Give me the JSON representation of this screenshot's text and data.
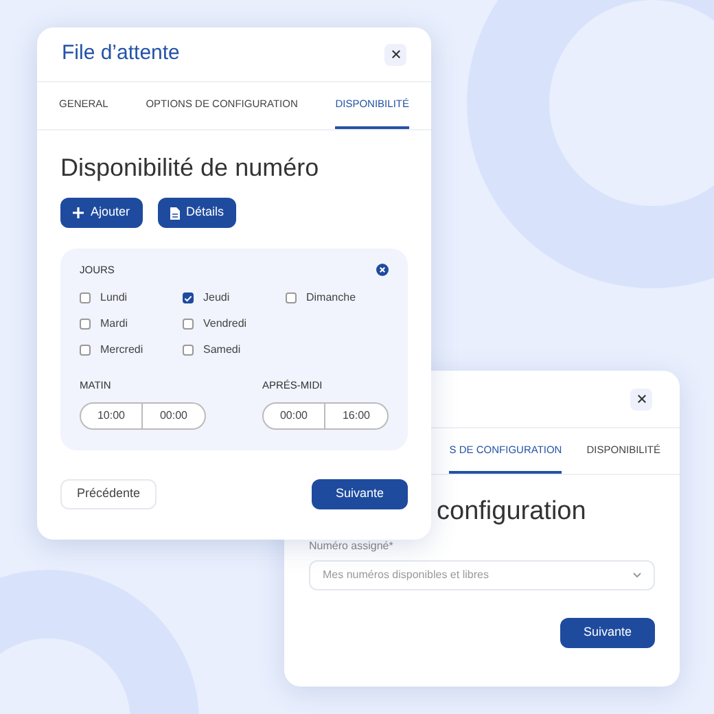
{
  "back_window": {
    "tabs": [
      {
        "label": "S DE CONFIGURATION",
        "selected": true
      },
      {
        "label": "DISPONIBILITÉ",
        "selected": false
      }
    ],
    "heading": "configuration",
    "field": {
      "label": "Numéro assigné*",
      "placeholder": "Mes numéros disponibles et libres"
    },
    "next_button": "Suivante"
  },
  "front_window": {
    "title": "File d’attente",
    "tabs": [
      {
        "label": "GENERAL",
        "selected": false
      },
      {
        "label": "OPTIONS DE CONFIGURATION",
        "selected": false
      },
      {
        "label": "DISPONIBILITÉ",
        "selected": true
      }
    ],
    "heading": "Disponibilité de numéro",
    "actions": [
      {
        "label": "Ajouter",
        "kind": "add"
      },
      {
        "label": "Détails",
        "kind": "document"
      }
    ],
    "days_panel": {
      "title": "JOURS",
      "day_columns": [
        [
          {
            "label": "Lundi",
            "checked": false
          },
          {
            "label": "Mardi",
            "checked": false
          },
          {
            "label": "Mercredi",
            "checked": false
          }
        ],
        [
          {
            "label": "Jeudi",
            "checked": true
          },
          {
            "label": "Vendredi",
            "checked": false
          },
          {
            "label": "Samedi",
            "checked": false
          }
        ],
        [
          {
            "label": "Dimanche",
            "checked": false
          }
        ]
      ],
      "time_ranges": [
        {
          "label": "MATIN",
          "from": "10:00",
          "to": "00:00"
        },
        {
          "label": "APRÉS-MIDI",
          "from": "00:00",
          "to": "16:00"
        }
      ]
    },
    "previous_button": "Précédente",
    "next_button": "Suivante"
  }
}
